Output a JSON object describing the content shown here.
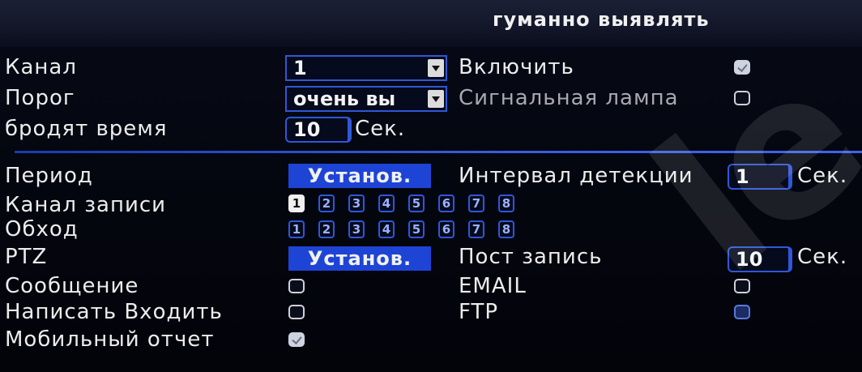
{
  "header": {
    "title": "гуманно выявлять"
  },
  "top": {
    "channel_label": "Канал",
    "channel_value": "1",
    "threshold_label": "Порог",
    "threshold_value": "очень вы",
    "wander_label": "бродят время",
    "wander_value": "10",
    "wander_unit": "Сек.",
    "enable_label": "Включить",
    "enable_checked": true,
    "alarm_lamp_label": "Сигнальная лампа",
    "alarm_lamp_checked": false
  },
  "bottom": {
    "period_label": "Период",
    "period_button": "Установ.",
    "interval_label": "Интервал детекции",
    "interval_value": "1",
    "interval_unit": "Сек.",
    "record_channel_label": "Канал записи",
    "record_channels": [
      "1",
      "2",
      "3",
      "4",
      "5",
      "6",
      "7",
      "8"
    ],
    "record_channel_selected": "1",
    "tour_label": "Обход",
    "tour_channels": [
      "1",
      "2",
      "3",
      "4",
      "5",
      "6",
      "7",
      "8"
    ],
    "ptz_label": "PTZ",
    "ptz_button": "Установ.",
    "post_record_label": "Пост запись",
    "post_record_value": "10",
    "post_record_unit": "Сек.",
    "message_label": "Сообщение",
    "message_checked": false,
    "email_label": "EMAIL",
    "email_checked": false,
    "write_input_label": "Написать Входить",
    "write_input_checked": false,
    "ftp_label": "FTP",
    "ftp_checked": false,
    "mobile_report_label": "Мобильный отчет",
    "mobile_report_checked": true
  },
  "watermark_text": "le",
  "colors": {
    "accent": "#2f57d8",
    "button": "#1e44d6",
    "background": "#05070f"
  }
}
